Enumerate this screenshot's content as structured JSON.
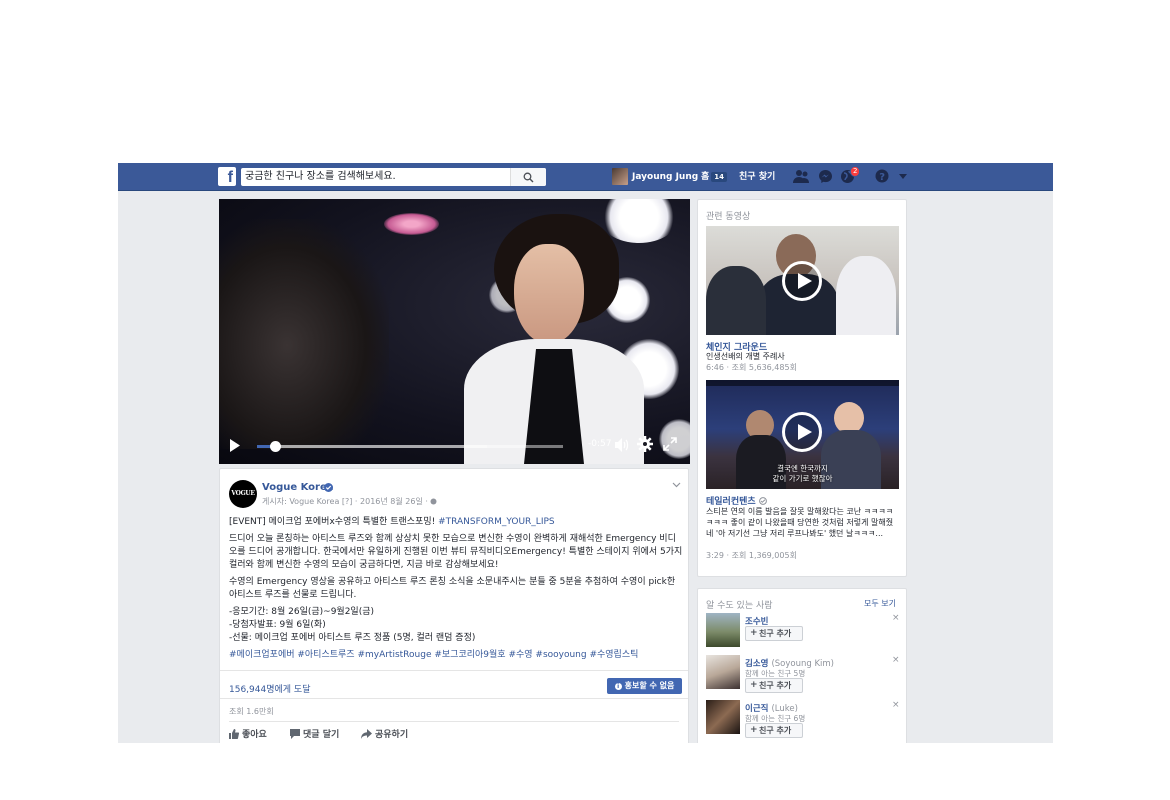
{
  "topbar": {
    "logo": "f",
    "search_placeholder": "궁금한 친구나 장소를 검색해보세요.",
    "user_name": "Jayoung Jung",
    "home_label": "홈",
    "home_count": "14",
    "find_friends": "친구 찾기",
    "notif_count": "2",
    "brand_color": "#3b5998"
  },
  "video": {
    "time_remaining": "-0:57",
    "progress": 0.06,
    "buffered": 0.75
  },
  "post": {
    "avatar_text": "VOGUE",
    "page_name": "Vogue Korea",
    "meta": "게시자: Vogue Korea [?] · 2016년 8월 26일 · ",
    "line1_prefix": "[EVENT] 메이크업 포에버x수영의 특별한 트랜스포밍! ",
    "line1_tag": "#TRANSFORM_YOUR_LIPS",
    "para2": "드디어 오늘 론칭하는 아티스트 루즈와 함께 상상치 못한 모습으로 변신한 수영이 완벽하게 재해석한 Emergency 비디오를 드디어 공개합니다. 한국에서만 유일하게 진행된 이번 뷰티 뮤직비디오Emergency! 특별한 스테이지 위에서 5가지 컬러와 함께 변신한 수영의 모습이 궁금하다면, 지금 바로 감상해보세요!",
    "para3": "수영의 Emergency 영상을 공유하고 아티스트 루즈 론칭 소식을 소문내주시는 분들 중 5분을 추첨하여 수영이 pick한 아티스트 루즈를 선물로 드립니다.",
    "line_period": "-응모기간: 8월 26일(금)~9월2일(금)",
    "line_winner": "-당첨자발표: 9월 6일(화)",
    "line_gift": "-선물: 메이크업 포에버 아티스트 루즈 정품 (5명, 컬러 랜덤 증정)",
    "hashtags": "#메이크업포에버 #아티스트루즈 #myArtistRouge #보그코리아9월호 #수영 #sooyoung #수영립스틱",
    "reach": "156,944명에게 도달",
    "boost": "홍보할 수 없음",
    "views": "조회 1.6만회",
    "actions": {
      "like": "좋아요",
      "comment": "댓글 달기",
      "share": "공유하기"
    }
  },
  "related": {
    "header": "관련 동영상",
    "items": [
      {
        "title": "체인지 그라운드",
        "desc": "인생선배의 개별 주례사",
        "meta": "6:46 · 조회 5,636,485회"
      },
      {
        "title": "테일러컨텐츠",
        "desc": "스티븐 연의 이름 발음을 잘못 말해왔다는 코난 ㅋㅋㅋㅋㅋㅋㅋ 좋이 같이 나왔을때 당연한 것처럼 저렇게 말해줬네 '아 저기선 그냥 저리 루프나봐도' 했던 날ㅋㅋㅋ...",
        "meta": "3:29 · 조회 1,369,005회",
        "caption1": "결국엔 한국까지",
        "caption2": "같이 가기로 했잖아"
      }
    ]
  },
  "pymk": {
    "header": "알 수도 있는 사람",
    "see_all": "모두 보기",
    "add_label": "친구 추가",
    "close": "×",
    "people": [
      {
        "name": "조수빈",
        "alt": "",
        "mutual": ""
      },
      {
        "name": "김소영",
        "alt": "(Soyoung Kim)",
        "mutual": "함께 아는 친구 5명"
      },
      {
        "name": "이근직",
        "alt": "(Luke)",
        "mutual": "함께 아는 친구 6명"
      }
    ]
  }
}
